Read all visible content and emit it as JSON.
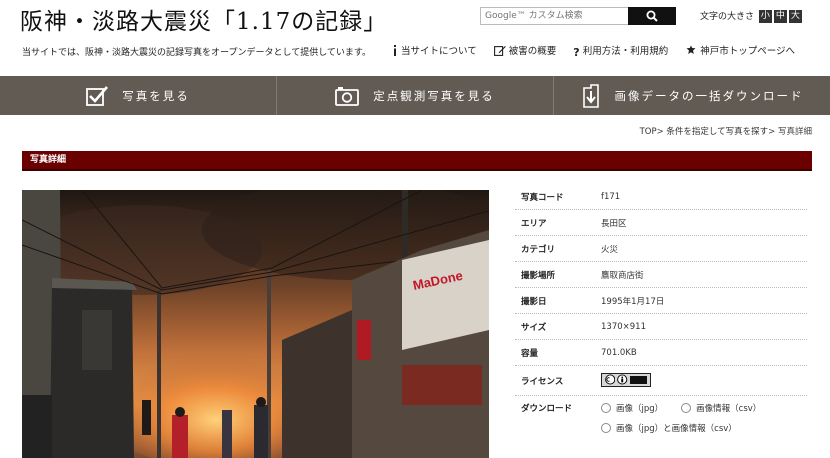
{
  "header": {
    "site_title": "阪神・淡路大震災「1.17の記録」",
    "tagline": "当サイトでは、阪神・淡路大震災の記録写真をオープンデータとして提供しています。",
    "search_placeholder": "Google™ カスタム検索",
    "font_size_label": "文字の大きさ",
    "font_sizes": [
      "小",
      "中",
      "大"
    ],
    "links": [
      "当サイトについて",
      "被害の概要",
      "利用方法・利用規約",
      "神戸市トップページへ"
    ]
  },
  "nav": {
    "items": [
      "写真を見る",
      "定点観測写真を見る",
      "画像データの一括ダウンロード"
    ]
  },
  "breadcrumb": {
    "items": [
      "TOP",
      "条件を指定して写真を探す",
      "写真詳細"
    ],
    "separator": ">"
  },
  "section": {
    "title": "写真詳細"
  },
  "details": {
    "rows": [
      {
        "label": "写真コード",
        "value": "f171"
      },
      {
        "label": "エリア",
        "value": "長田区"
      },
      {
        "label": "カテゴリ",
        "value": "火災"
      },
      {
        "label": "撮影場所",
        "value": "鷹取商店街"
      },
      {
        "label": "撮影日",
        "value": "1995年1月17日"
      },
      {
        "label": "サイズ",
        "value": "1370×911"
      },
      {
        "label": "容量",
        "value": "701.0KB"
      }
    ],
    "license_label": "ライセンス",
    "download_label": "ダウンロード",
    "download_options": [
      "画像（jpg）",
      "画像情報（csv）",
      "画像（jpg）と画像情報（csv）"
    ]
  },
  "photo": {
    "sign_text": "MaDone"
  },
  "colors": {
    "nav_bg": "#625b53",
    "section_bar": "#6b0000",
    "search_button": "#111111"
  }
}
